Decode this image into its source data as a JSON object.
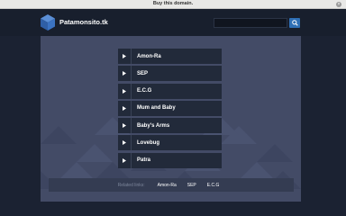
{
  "topbar": {
    "label": "Buy this domain."
  },
  "header": {
    "site_name": "Patamonsito.tk",
    "search": {
      "value": "",
      "placeholder": ""
    }
  },
  "links": [
    {
      "label": "Amon-Ra"
    },
    {
      "label": "SEP"
    },
    {
      "label": "E.C.G"
    },
    {
      "label": "Mum and Baby"
    },
    {
      "label": "Baby's Arms"
    },
    {
      "label": "Lovebug"
    },
    {
      "label": "Patra"
    }
  ],
  "related": {
    "title": "Related links:",
    "links": [
      "Amon-Ra",
      "SEP",
      "E.C.G"
    ]
  },
  "colors": {
    "background": "#1b2232",
    "panel": "#434b66",
    "link_bar": "#222a3a",
    "accent": "#2e6fb5",
    "logo": "#3b73c2"
  },
  "icons": [
    "logo-cube-icon",
    "search-icon",
    "arrow-right-icon",
    "close-icon"
  ]
}
